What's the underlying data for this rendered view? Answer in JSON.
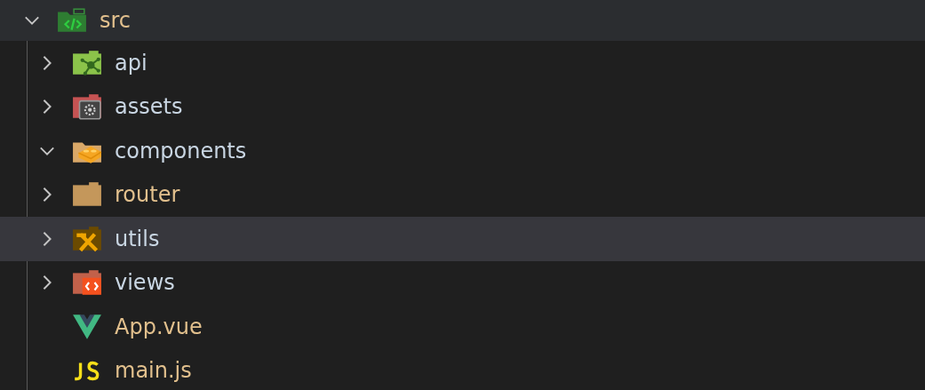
{
  "tree": {
    "label": "src",
    "kind": "folder",
    "expanded": true,
    "modified": true,
    "selected": false,
    "children": [
      {
        "label": "api",
        "kind": "folder",
        "expanded": false,
        "modified": false,
        "selected": false
      },
      {
        "label": "assets",
        "kind": "folder",
        "expanded": false,
        "modified": false,
        "selected": false
      },
      {
        "label": "components",
        "kind": "folder",
        "expanded": true,
        "modified": false,
        "selected": false
      },
      {
        "label": "router",
        "kind": "folder",
        "expanded": false,
        "modified": true,
        "selected": false
      },
      {
        "label": "utils",
        "kind": "folder",
        "expanded": false,
        "modified": false,
        "selected": true
      },
      {
        "label": "views",
        "kind": "folder",
        "expanded": false,
        "modified": false,
        "selected": false
      },
      {
        "label": "App.vue",
        "kind": "file",
        "modified": true,
        "selected": false
      },
      {
        "label": "main.js",
        "kind": "file",
        "modified": true,
        "selected": false
      }
    ]
  }
}
